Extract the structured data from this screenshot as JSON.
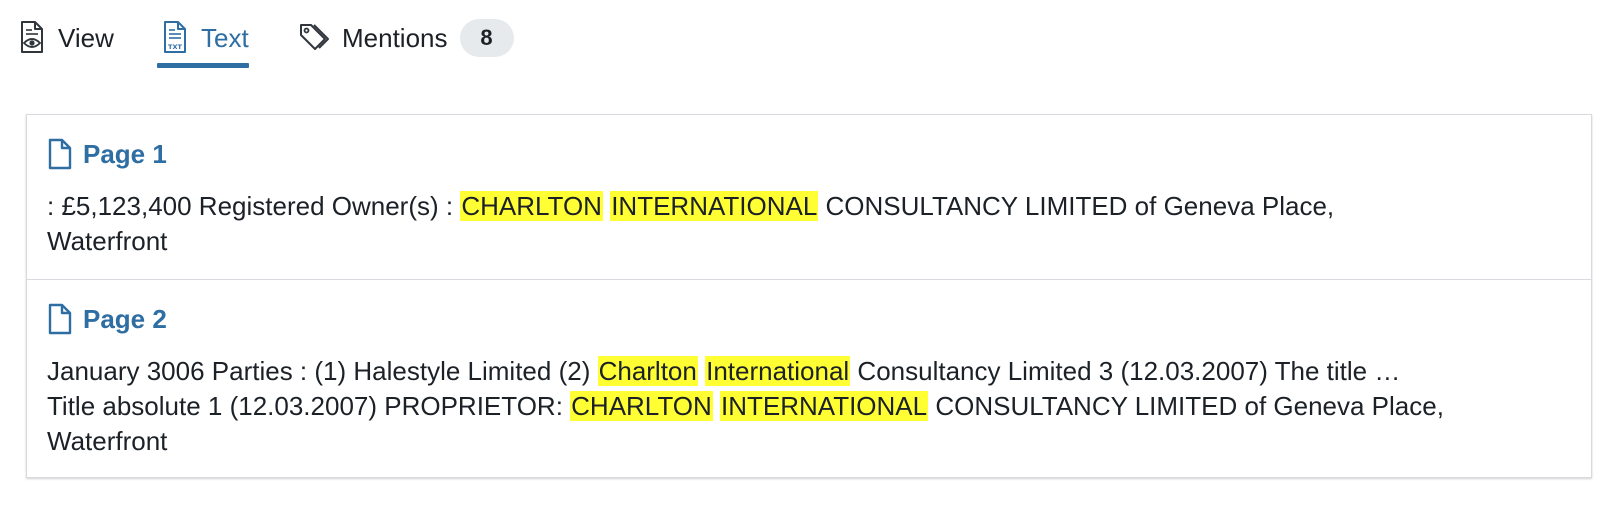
{
  "tabs": [
    {
      "label": "View",
      "icon": "document-eye-icon",
      "active": false
    },
    {
      "label": "Text",
      "icon": "document-text-icon",
      "active": true
    },
    {
      "label": "Mentions",
      "icon": "tags-icon",
      "active": false,
      "count": "8"
    }
  ],
  "colors": {
    "accent": "#2e6ea3",
    "highlight": "#ffff33",
    "badge_bg": "#e7eaed"
  },
  "pages": [
    {
      "title": "Page 1",
      "icon": "page-icon",
      "lines": [
        [
          {
            "text": ": £5,123,400 Registered Owner(s) : ",
            "hl": false
          },
          {
            "text": "CHARLTON",
            "hl": true
          },
          {
            "text": " ",
            "hl": false
          },
          {
            "text": "INTERNATIONAL",
            "hl": true
          },
          {
            "text": " CONSULTANCY LIMITED of Geneva Place,",
            "hl": false
          }
        ],
        [
          {
            "text": "Waterfront",
            "hl": false
          }
        ]
      ]
    },
    {
      "title": "Page 2",
      "icon": "page-icon",
      "lines": [
        [
          {
            "text": "January 3006 Parties : (1) Halestyle Limited (2) ",
            "hl": false
          },
          {
            "text": "Charlton",
            "hl": true
          },
          {
            "text": " ",
            "hl": false
          },
          {
            "text": "International",
            "hl": true
          },
          {
            "text": " Consultancy Limited 3 (12.03.2007) The title …",
            "hl": false
          }
        ],
        [
          {
            "text": "Title absolute 1 (12.03.2007) PROPRIETOR: ",
            "hl": false
          },
          {
            "text": "CHARLTON",
            "hl": true
          },
          {
            "text": " ",
            "hl": false
          },
          {
            "text": "INTERNATIONAL",
            "hl": true
          },
          {
            "text": " CONSULTANCY LIMITED of Geneva Place,",
            "hl": false
          }
        ],
        [
          {
            "text": "Waterfront",
            "hl": false
          }
        ]
      ]
    }
  ]
}
